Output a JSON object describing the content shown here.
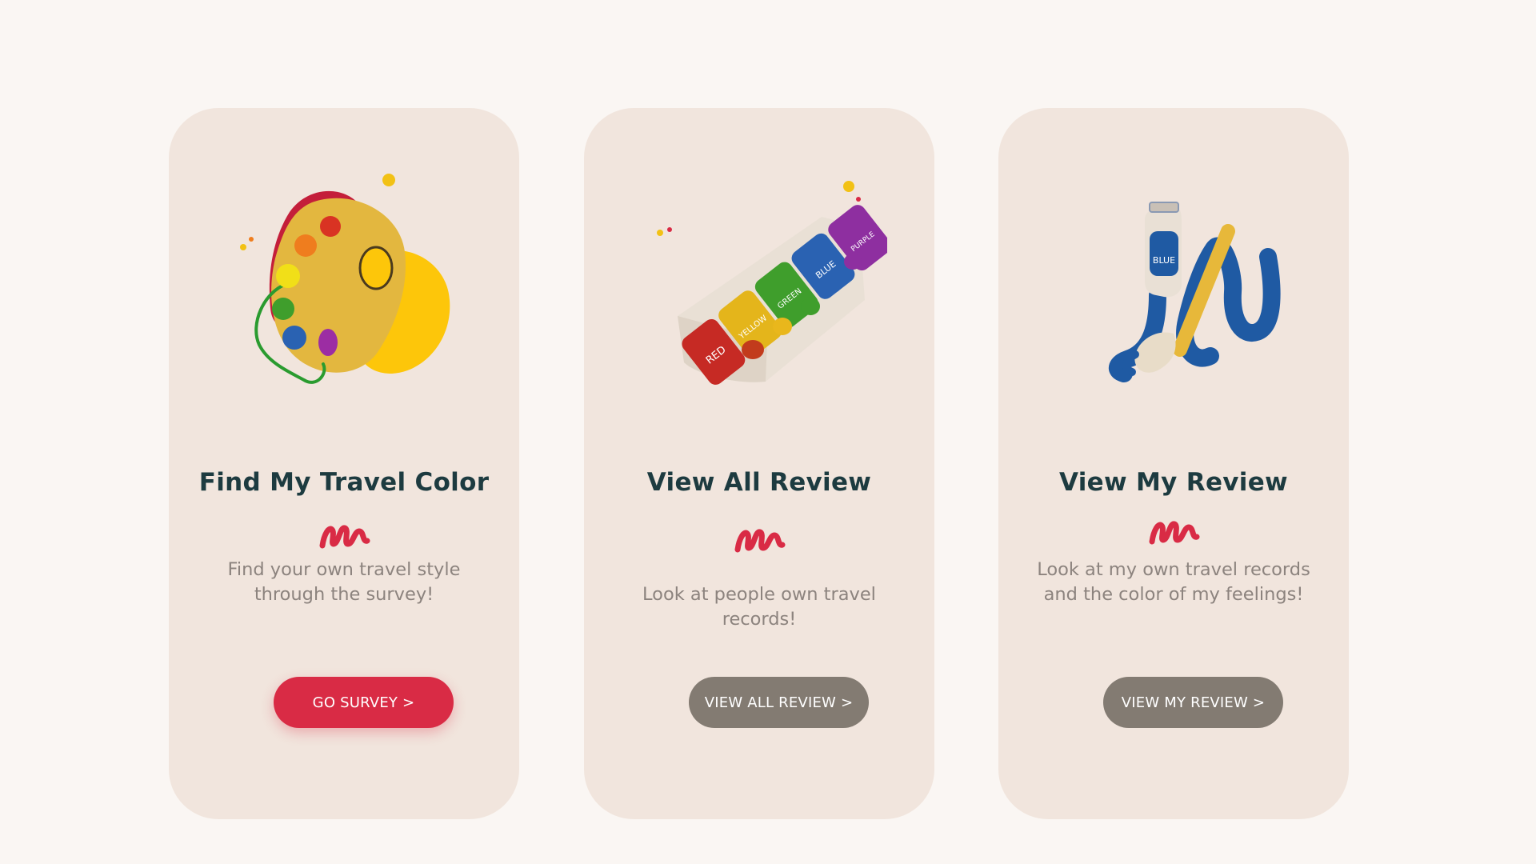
{
  "colors": {
    "page_background": "#faf6f3",
    "card_background": "#f1e5dd",
    "title_color": "#1d3b40",
    "description_color": "#8c837e",
    "accent_red": "#d92b45",
    "button_gray": "#837b72"
  },
  "cards": [
    {
      "illustration": "paint-palette-illustration",
      "title": "Find My Travel Color",
      "description_lines": [
        "Find your own travel style",
        "through the survey!"
      ],
      "button_label": "GO SURVEY >"
    },
    {
      "illustration": "paint-tubes-box-illustration",
      "title": "View All Review",
      "description_lines": [
        "Look at people own travel records!"
      ],
      "button_label": "VIEW ALL REVIEW >"
    },
    {
      "illustration": "blue-paint-tube-brush-illustration",
      "title": "View My Review",
      "description_lines": [
        "Look at my own travel records",
        "and the color of my feelings!"
      ],
      "button_label": "VIEW MY REVIEW >"
    }
  ],
  "tube_labels": [
    "RED",
    "YELLOW",
    "GREEN",
    "BLUE",
    "PURPLE"
  ],
  "single_tube_label": "BLUE"
}
